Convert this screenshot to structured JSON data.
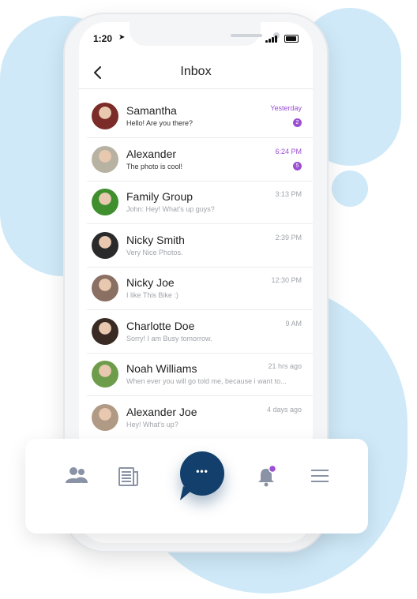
{
  "status": {
    "time": "1:20",
    "location_glyph": "➤"
  },
  "header": {
    "title": "Inbox",
    "back_icon": "chevron-left-icon"
  },
  "conversations": [
    {
      "name": "Samantha",
      "preview": "Hello! Are you there?",
      "time": "Yesterday",
      "badge": "2",
      "highlight": true,
      "avatar_color": "#7b2b28"
    },
    {
      "name": "Alexander",
      "preview": "The photo is cool!",
      "time": "6:24 PM",
      "badge": "5",
      "highlight": true,
      "avatar_color": "#b8b2a2"
    },
    {
      "name": "Family Group",
      "preview": "John: Hey! What's up guys?",
      "time": "3:13 PM",
      "badge": "",
      "highlight": false,
      "avatar_color": "#3f8f2e"
    },
    {
      "name": "Nicky  Smith",
      "preview": "Very Nice Photos.",
      "time": "2:39 PM",
      "badge": "",
      "highlight": false,
      "avatar_color": "#2a2a2a"
    },
    {
      "name": "Nicky Joe",
      "preview": "I like This Bike :)",
      "time": "12:30 PM",
      "badge": "",
      "highlight": false,
      "avatar_color": "#8a6f63"
    },
    {
      "name": "Charlotte Doe",
      "preview": "Sorry! I am Busy tomorrow.",
      "time": "9 AM",
      "badge": "",
      "highlight": false,
      "avatar_color": "#3a2a24"
    },
    {
      "name": "Noah Williams",
      "preview": "When ever you will go told me, because i want to...",
      "time": "21 hrs ago",
      "badge": "",
      "highlight": false,
      "avatar_color": "#6d9c4b"
    },
    {
      "name": "Alexander Joe",
      "preview": "Hey! What's up?",
      "time": "4 days ago",
      "badge": "",
      "highlight": false,
      "avatar_color": "#b09a86"
    }
  ],
  "nav": {
    "items": [
      "contacts-icon",
      "news-icon",
      "chat-icon",
      "bell-icon",
      "menu-icon"
    ],
    "active": "chat-icon",
    "fab_glyph": "•••"
  },
  "colors": {
    "accent": "#9b4fd3",
    "fab": "#123f6b",
    "background_blob": "#cfe9f8",
    "icon_gray": "#8a93a6"
  }
}
